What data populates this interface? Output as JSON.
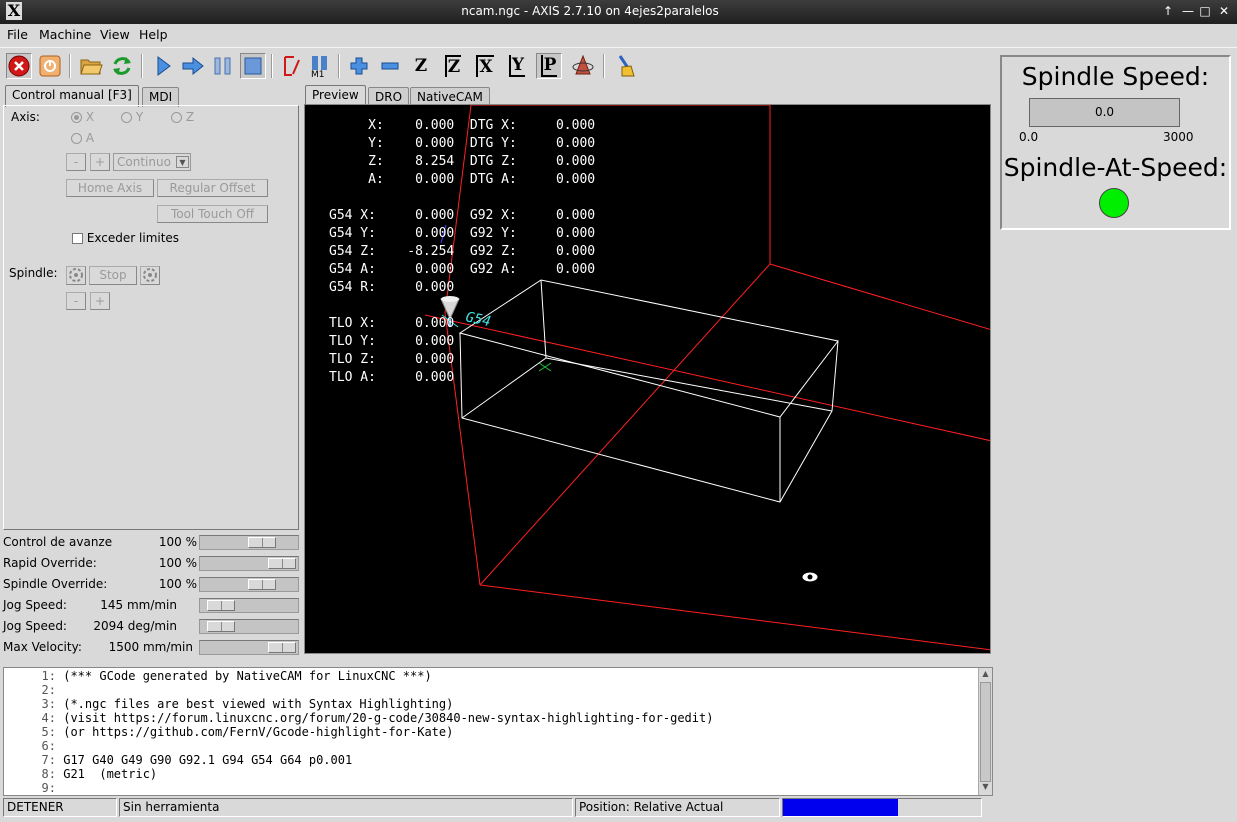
{
  "window": {
    "title": "ncam.ngc - AXIS 2.7.10 on 4ejes2paralelos"
  },
  "menu": {
    "file": "File",
    "machine": "Machine",
    "view": "View",
    "help": "Help"
  },
  "toolbar": {
    "icons": [
      "estop-icon",
      "power-icon",
      "open-file-icon",
      "reload-icon",
      "run-icon",
      "step-icon",
      "pause-icon",
      "stop-icon",
      "block-delete-icon",
      "optional-stop-icon",
      "zoom-in-icon",
      "zoom-out-icon",
      "view-z-icon",
      "view-z2-icon",
      "view-x-icon",
      "view-y-icon",
      "view-p-icon",
      "rotate-view-icon",
      "clear-plot-icon"
    ],
    "letters": {
      "z": "Z",
      "z2": "Z",
      "x": "X",
      "y": "Y",
      "p": "P",
      "m1": "M1"
    }
  },
  "left_tabs": {
    "manual": "Control manual [F3]",
    "mdi": "MDI"
  },
  "manual": {
    "axis_label": "Axis:",
    "axes": [
      "X",
      "Y",
      "Z",
      "A"
    ],
    "minus": "-",
    "plus": "+",
    "jog_mode": "Continuo",
    "home_axis": "Home Axis",
    "regular_offset": "Regular Offset",
    "tool_touch_off": "Tool Touch Off",
    "override_limits": "Exceder limites",
    "spindle_label": "Spindle:",
    "spindle_stop": "Stop"
  },
  "sliders": [
    {
      "label": "Control de avanze",
      "value": "100 %",
      "level": 0.7
    },
    {
      "label": "Rapid Override:",
      "value": "100 %",
      "level": 1.0
    },
    {
      "label": "Spindle Override:",
      "value": "100 %",
      "level": 0.7
    },
    {
      "label": "Jog Speed:",
      "value": "145 mm/min",
      "level": 0.1
    },
    {
      "label": "Jog Speed:",
      "value": "2094 deg/min",
      "level": 0.1
    },
    {
      "label": "Max Velocity:",
      "value": "1500 mm/min",
      "level": 1.0
    }
  ],
  "preview_tabs": {
    "preview": "Preview",
    "dro": "DRO",
    "nativecam": "NativeCAM"
  },
  "dro_lines": [
    "     X:    0.000  DTG X:     0.000",
    "     Y:    0.000  DTG Y:     0.000",
    "     Z:    8.254  DTG Z:     0.000",
    "     A:    0.000  DTG A:     0.000",
    "",
    "G54 X:     0.000  G92 X:     0.000",
    "G54 Y:     0.000  G92 Y:     0.000",
    "G54 Z:    -8.254  G92 Z:     0.000",
    "G54 A:     0.000  G92 A:     0.000",
    "G54 R:     0.000",
    "",
    "TLO X:     0.000",
    "TLO Y:     0.000",
    "TLO Z:     0.000",
    "TLO A:     0.000"
  ],
  "preview_label": "G54",
  "gcode": [
    {
      "n": "1:",
      "text": "(*** GCode generated by NativeCAM for LinuxCNC ***)"
    },
    {
      "n": "2:",
      "text": ""
    },
    {
      "n": "3:",
      "text": "(*.ngc files are best viewed with Syntax Highlighting)"
    },
    {
      "n": "4:",
      "text": "(visit https://forum.linuxcnc.org/forum/20-g-code/30840-new-syntax-highlighting-for-gedit)"
    },
    {
      "n": "5:",
      "text": "(or https://github.com/FernV/Gcode-highlight-for-Kate)"
    },
    {
      "n": "6:",
      "text": ""
    },
    {
      "n": "7:",
      "text": "G17 G40 G49 G90 G92.1 G94 G54 G64 p0.001"
    },
    {
      "n": "8:",
      "text": "G21  (metric)"
    },
    {
      "n": "9:",
      "text": ""
    }
  ],
  "status": {
    "state": "DETENER",
    "tool": "Sin herramienta",
    "position": "Position: Relative Actual"
  },
  "spindle_panel": {
    "speed_title": "Spindle Speed:",
    "speed_value": "0.0",
    "scale_min": "0.0",
    "scale_max": "3000",
    "at_speed_title": "Spindle-At-Speed:",
    "led_color": "#00ee00"
  },
  "colors": {
    "limit_box": "#ff2020",
    "stock_box": "#ffffff",
    "status_progress": "#0000ee"
  }
}
